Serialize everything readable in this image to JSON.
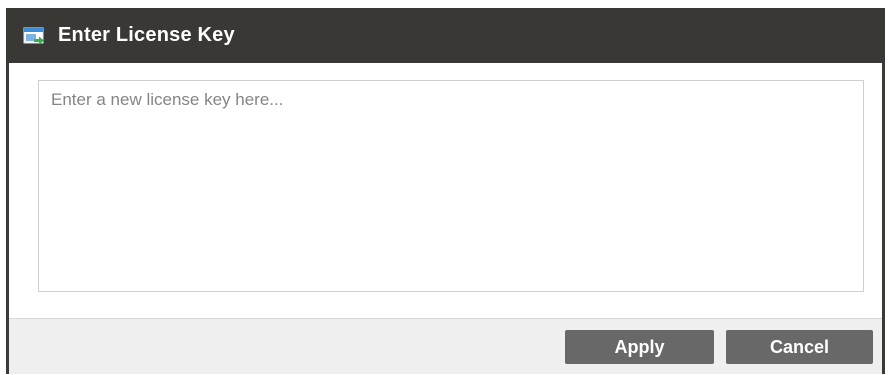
{
  "dialog": {
    "title": "Enter License Key",
    "icon": "license-window-icon"
  },
  "license_input": {
    "placeholder": "Enter a new license key here...",
    "value": ""
  },
  "buttons": {
    "apply_label": "Apply",
    "cancel_label": "Cancel"
  },
  "colors": {
    "titlebar": "#3a3835",
    "button": "#686868",
    "footer": "#efefef",
    "icon_blue": "#3d8ed6",
    "icon_green": "#3fae49"
  }
}
